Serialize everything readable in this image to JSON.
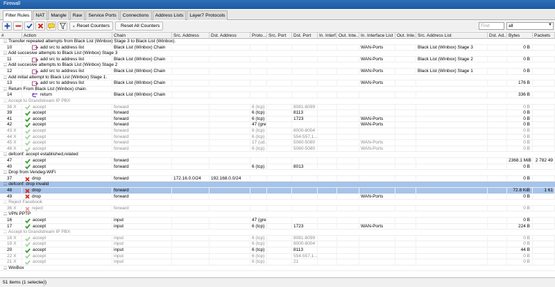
{
  "window": {
    "title": "Firewall"
  },
  "tabs": [
    {
      "label": "Filter Rules",
      "active": true
    },
    {
      "label": "NAT"
    },
    {
      "label": "Mangle"
    },
    {
      "label": "Raw"
    },
    {
      "label": "Service Ports"
    },
    {
      "label": "Connections"
    },
    {
      "label": "Address Lists"
    },
    {
      "label": "Layer7 Protocols"
    }
  ],
  "toolbar": {
    "reset_counters_label": "Reset Counters",
    "reset_all_counters_label": "Reset All Counters",
    "find_placeholder": "Find",
    "filter_value": "all",
    "icons": [
      "add-icon",
      "remove-icon",
      "enable-icon",
      "disable-icon",
      "comment-icon",
      "filter-icon",
      "reset-counters-icon",
      "reset-all-counters-icon"
    ]
  },
  "columns": [
    "#",
    "Action",
    "Chain",
    "Src. Address",
    "Dst. Address",
    "Proto...",
    "Src. Port",
    "Dst. Port",
    "In. Interf...",
    "Out. Inte...",
    "In. Interface List",
    "Out. Inte...",
    "Src. Address List",
    "Dst. Ad...",
    "Bytes",
    "Packets"
  ],
  "colors": {
    "accept": "#34a02c",
    "drop": "#d42a1c",
    "add": "#a0427a",
    "return": "#7b45b8",
    "selected": "#a6c3e9",
    "disabled_text": "#8d8d8d"
  },
  "rows": [
    {
      "type": "comment",
      "text": ";;; Transfer repeated attempts from Black List (Winbox) Stage 3 to Black List (Winbox)."
    },
    {
      "num": "10",
      "action": "add src to address list",
      "action_kind": "add",
      "chain": "Black List (Winbox) Chain",
      "in_if_list": "WAN-Ports",
      "src_list": "Black List (Winbox) Stage 3",
      "bytes": "0 B"
    },
    {
      "type": "comment",
      "text": ";;; Add succesive attempts to Black List (Winbox) Stage 3"
    },
    {
      "num": "11",
      "action": "add src to address list",
      "action_kind": "add",
      "chain": "Black List (Winbox) Chain",
      "in_if_list": "WAN-Ports",
      "src_list": "Black List (Winbox) Stage 2",
      "bytes": "0 B"
    },
    {
      "type": "comment",
      "text": ";;; Add succesive attempts to Black List (Winbox) Stage 2"
    },
    {
      "num": "12",
      "action": "add src to address list",
      "action_kind": "add",
      "chain": "Black List (Winbox) Chain",
      "in_if_list": "WAN-Ports",
      "src_list": "Black List (Winbox) Stage 1",
      "bytes": "0 B"
    },
    {
      "type": "comment",
      "text": ";;; Add initial attempt to Black List (Winbox) Stage 1."
    },
    {
      "num": "13",
      "action": "add src to address list",
      "action_kind": "add",
      "chain": "Black List (Winbox) Chain",
      "in_if_list": "WAN-Ports",
      "bytes": "176 B"
    },
    {
      "type": "comment",
      "text": ";;; Return From Black List (Winbox) chain."
    },
    {
      "num": "14",
      "action": "return",
      "action_kind": "return",
      "chain": "Black List (Winbox) Chain",
      "bytes": "336 B"
    },
    {
      "type": "comment",
      "disabled": true,
      "text": ";;; Accept to Grandstream IP PBX"
    },
    {
      "num": "38",
      "flag": "X",
      "disabled": true,
      "action": "accept",
      "action_kind": "accept",
      "chain": "forward",
      "proto": "6 (tcp)",
      "dst_port": "8081-8099",
      "bytes": "0 B"
    },
    {
      "num": "39",
      "action": "accept",
      "action_kind": "accept",
      "chain": "forward",
      "proto": "6 (tcp)",
      "dst_port": "8113",
      "bytes": "0 B"
    },
    {
      "num": "41",
      "action": "accept",
      "action_kind": "accept",
      "chain": "forward",
      "proto": "6 (tcp)",
      "dst_port": "1723",
      "in_if_list": "WAN-Ports",
      "bytes": "0 B"
    },
    {
      "num": "42",
      "action": "accept",
      "action_kind": "accept",
      "chain": "forward",
      "proto": "47 (gre)",
      "in_if_list": "WAN-Ports",
      "bytes": "0 B"
    },
    {
      "num": "43",
      "flag": "X",
      "disabled": true,
      "action": "accept",
      "action_kind": "accept",
      "chain": "forward",
      "proto": "6 (tcp)",
      "dst_port": "8000-8004",
      "bytes": "0 B"
    },
    {
      "num": "44",
      "flag": "X",
      "disabled": true,
      "action": "accept",
      "action_kind": "accept",
      "chain": "forward",
      "proto": "6 (tcp)",
      "dst_port": "554-557,1...",
      "bytes": "0 B"
    },
    {
      "num": "45",
      "flag": "X",
      "disabled": true,
      "action": "accept",
      "action_kind": "accept",
      "chain": "forward",
      "proto": "17 (ud...",
      "dst_port": "5060-5080",
      "in_if_list": "WAN-Ports",
      "bytes": "0 B"
    },
    {
      "num": "46",
      "flag": "X",
      "disabled": true,
      "action": "accept",
      "action_kind": "accept",
      "chain": "forward",
      "proto": "6 (tcp)",
      "dst_port": "5060-5080",
      "in_if_list": "WAN-Ports",
      "bytes": "0 B"
    },
    {
      "type": "comment",
      "text": ";;; defconf: accept established,related"
    },
    {
      "num": "47",
      "action": "accept",
      "action_kind": "accept",
      "chain": "forward",
      "bytes": "2368.1 MiB",
      "packets": "2 782 49"
    },
    {
      "num": "40",
      "action": "accept",
      "action_kind": "accept",
      "chain": "forward",
      "proto": "6 (tcp)",
      "dst_port": "8013",
      "bytes": "0 B"
    },
    {
      "type": "comment",
      "text": ";;; Drop from Vendeg-WiFi"
    },
    {
      "num": "37",
      "action": "drop",
      "action_kind": "drop",
      "chain": "forward",
      "src_addr": "172.16.0.0/24",
      "dst_addr": "192.168.0.0/24",
      "bytes": "0 B"
    },
    {
      "type": "comment",
      "selected": true,
      "text": ";;; defconf: drop invalid"
    },
    {
      "num": "48",
      "selected": true,
      "action": "drop",
      "action_kind": "drop",
      "chain": "forward",
      "bytes": "72.8 KiB",
      "packets": "1 61"
    },
    {
      "num": "49",
      "action": "drop",
      "action_kind": "drop",
      "chain": "forward",
      "in_if_list": "WAN-Ports",
      "bytes": "0 B"
    },
    {
      "type": "comment",
      "disabled": true,
      "text": ";;; Reject Facebook"
    },
    {
      "num": "36",
      "flag": "X",
      "disabled": true,
      "action": "reject",
      "action_kind": "drop",
      "chain": "forward",
      "bytes": "0 B"
    },
    {
      "type": "comment",
      "text": ";;; VPN PPTP"
    },
    {
      "num": "16",
      "action": "accept",
      "action_kind": "accept",
      "chain": "input",
      "proto": "47 (gre)",
      "bytes": "0 B"
    },
    {
      "num": "17",
      "action": "accept",
      "action_kind": "accept",
      "chain": "input",
      "proto": "6 (tcp)",
      "dst_port": "1723",
      "in_if_list": "WAN-Ports",
      "bytes": "224 B"
    },
    {
      "type": "comment",
      "disabled": true,
      "text": ";;; Accept to Grandstream IP PBX"
    },
    {
      "num": "18",
      "flag": "X",
      "disabled": true,
      "action": "accept",
      "action_kind": "accept",
      "chain": "input",
      "proto": "6 (tcp)",
      "dst_port": "8081-8099",
      "bytes": "0 B"
    },
    {
      "num": "19",
      "flag": "X",
      "disabled": true,
      "action": "accept",
      "action_kind": "accept",
      "chain": "input",
      "proto": "6 (tcp)",
      "dst_port": "8000-8004",
      "bytes": "0 B"
    },
    {
      "num": "20",
      "action": "accept",
      "action_kind": "accept",
      "chain": "input",
      "proto": "6 (tcp)",
      "dst_port": "8113",
      "bytes": "44 B"
    },
    {
      "num": "22",
      "flag": "X",
      "disabled": true,
      "action": "accept",
      "action_kind": "accept",
      "chain": "input",
      "proto": "6 (tcp)",
      "dst_port": "554-557,1...",
      "bytes": "0 B"
    },
    {
      "num": "21",
      "flag": "X",
      "disabled": true,
      "action": "accept",
      "action_kind": "accept",
      "chain": "input",
      "proto": "6 (tcp)",
      "dst_port": "21",
      "bytes": "0 B"
    },
    {
      "type": "comment",
      "text": ";;; WinBox"
    }
  ],
  "status": {
    "text": "51 items (1 selected)"
  }
}
